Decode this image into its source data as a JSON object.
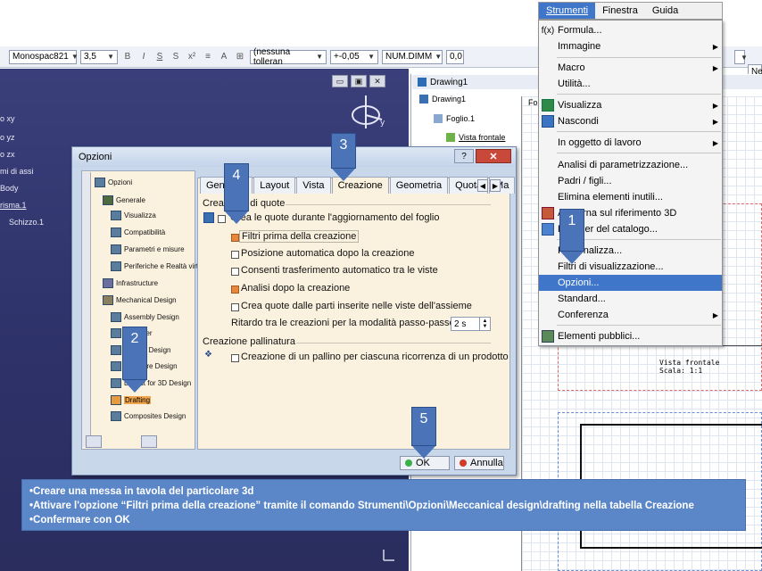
{
  "toolbar": {
    "font": "Monospac821",
    "size": "3,5",
    "tolerance": "(nessuna tolleran",
    "tolvalue": "+-0,05",
    "numformat": "NUM.DIMM",
    "numvalue": "0,0",
    "right_field": "Ne"
  },
  "workspace_tree": [
    "o xy",
    "o yz",
    "o zx",
    "mi di assi",
    "Body",
    "risma.1",
    "Schizzo.1"
  ],
  "drawing": {
    "title": "Drawing1",
    "tree": [
      "Drawing1",
      "Foglio.1",
      "Vista frontale"
    ],
    "frame_label": "Fo",
    "view_label": "Vista frontale",
    "scale_label": "Scala:  1:1"
  },
  "menubar": {
    "items": [
      "Strumenti",
      "Finestra",
      "Guida"
    ]
  },
  "menu": {
    "items": [
      "Formula...",
      "Immagine",
      "Macro",
      "Utilità...",
      "Visualizza",
      "Nascondi",
      "In oggetto di lavoro",
      "Analisi di parametrizzazione...",
      "Padri / figli...",
      "Elimina elementi inutili...",
      "Aggiorna sul riferimento 3D",
      "Browser del catalogo...",
      "Personalizza...",
      "Filtri di visualizzazione...",
      "Opzioni...",
      "Standard...",
      "Conferenza",
      "Elementi pubblici..."
    ]
  },
  "dialog": {
    "title": "Opzioni",
    "help": "?",
    "close": "✕",
    "tree": [
      "Opzioni",
      "Generale",
      "Visualizza",
      "Compatibilità",
      "Parametri e misure",
      "Periferiche e Realtà virtu",
      "Infrastructure",
      "Mechanical Design",
      "Assembly Design",
      "Sketcher",
      "Tooling Design",
      "Structure Design",
      "Layout for 3D Design",
      "Drafting",
      "Composites Design"
    ],
    "tabs": [
      "Generale",
      "Layout",
      "Vista",
      "Creazione",
      "Geometria",
      "Quota",
      "Ma"
    ],
    "section1": "Creazione di quote",
    "opt1": "Crea le quote durante l'aggiornamento del foglio",
    "opt2": "Filtri prima della creazione",
    "opt3": "Posizione automatica dopo la creazione",
    "opt4": "Consenti trasferimento automatico tra le viste",
    "opt5": "Analisi dopo la creazione",
    "opt6": "Crea quote dalle parti inserite nelle viste dell'assieme",
    "delay_label": "Ritardo tra le creazioni per la modalità passo-passo:",
    "delay_value": "2 s",
    "section2": "Creazione pallinatura",
    "opt7": "Creazione di un pallino per ciascuna ricorrenza di un prodotto",
    "ok": "OK",
    "cancel": "Annulla"
  },
  "arrows": [
    "1",
    "2",
    "3",
    "4",
    "5"
  ],
  "caption": {
    "line1": "•Creare una messa in tavola del particolare 3d",
    "line2": "•Attivare l'opzione “Filtri prima della creazione” tramite il comando Strumenti\\Opzioni\\Meccanical design\\drafting  nella tabella Creazione",
    "line3": "•Confermare con OK"
  },
  "colors": {
    "accent": "#3f76c9",
    "arrow": "#4a73b8",
    "workspace": "#2d3168",
    "panel": "#fbf1df"
  }
}
